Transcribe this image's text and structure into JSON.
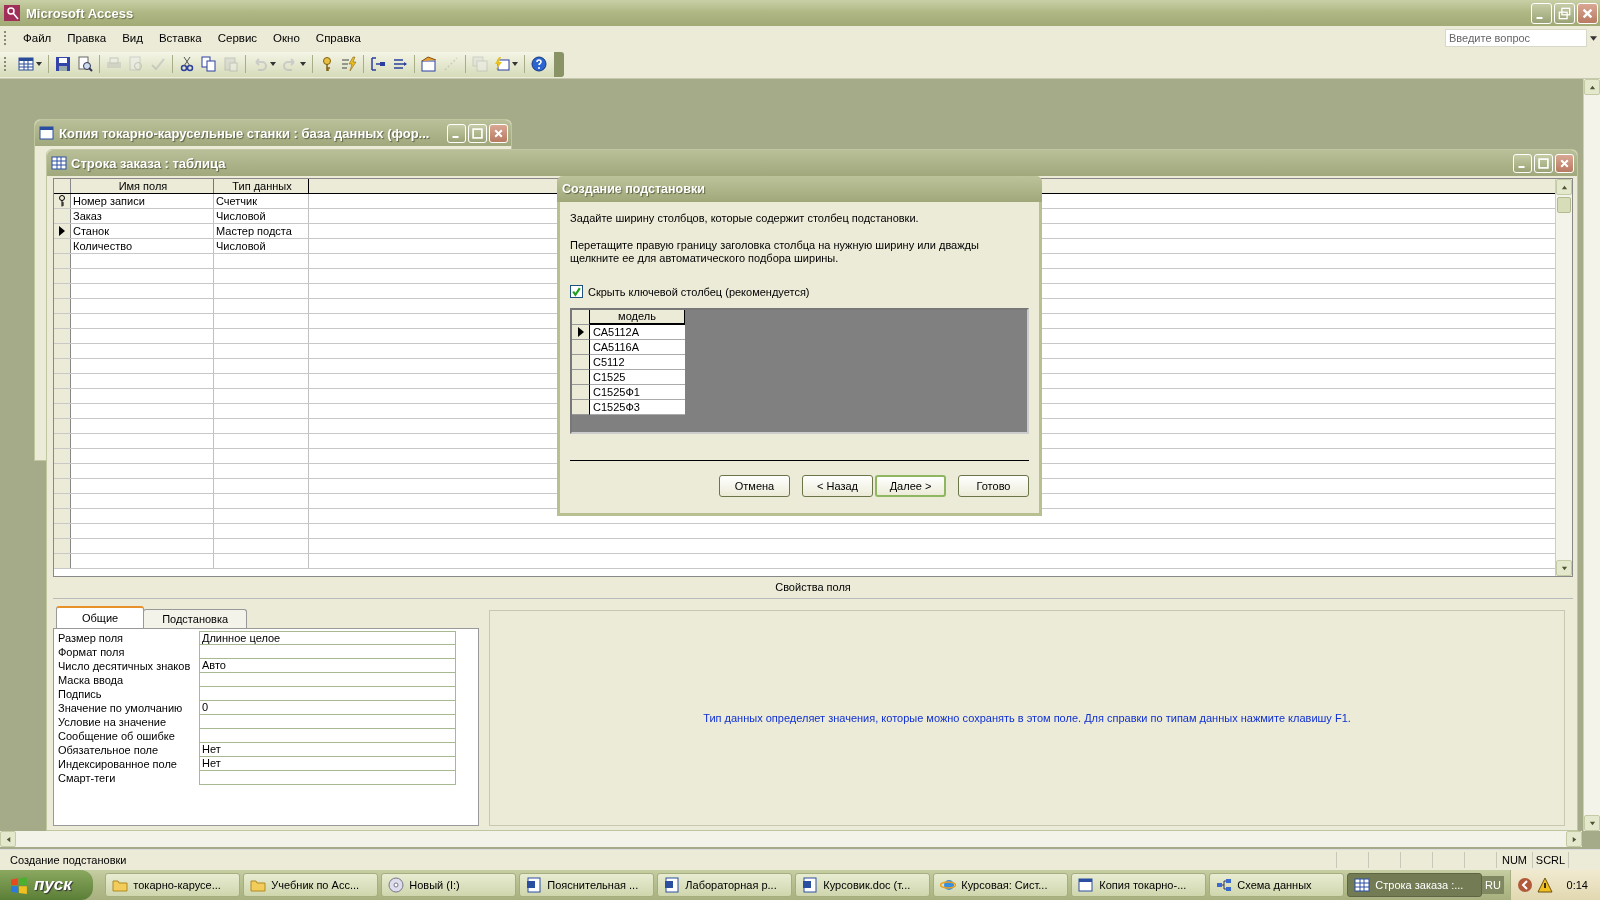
{
  "window": {
    "title": "Microsoft Access"
  },
  "menu": [
    "Файл",
    "Правка",
    "Вид",
    "Вставка",
    "Сервис",
    "Окно",
    "Справка"
  ],
  "help_box": {
    "placeholder": "Введите вопрос"
  },
  "toolbar": [
    [
      {
        "kind": "grid",
        "dropdown": true,
        "disabled": false
      }
    ],
    [
      {
        "kind": "save",
        "dropdown": false,
        "disabled": false
      },
      {
        "kind": "search",
        "dropdown": false,
        "disabled": false
      }
    ],
    [
      {
        "kind": "print",
        "dropdown": false,
        "disabled": true
      },
      {
        "kind": "preview",
        "dropdown": false,
        "disabled": true
      },
      {
        "kind": "spell",
        "dropdown": false,
        "disabled": true
      }
    ],
    [
      {
        "kind": "cut",
        "dropdown": false,
        "disabled": false
      },
      {
        "kind": "copy",
        "dropdown": false,
        "disabled": false
      },
      {
        "kind": "paste",
        "dropdown": false,
        "disabled": true
      }
    ],
    [
      {
        "kind": "undo",
        "dropdown": true,
        "disabled": true
      },
      {
        "kind": "redo",
        "dropdown": true,
        "disabled": true
      }
    ],
    [
      {
        "kind": "key",
        "dropdown": false,
        "disabled": false
      },
      {
        "kind": "lightning",
        "dropdown": false,
        "disabled": false
      }
    ],
    [
      {
        "kind": "insert",
        "dropdown": false,
        "disabled": false
      },
      {
        "kind": "delete",
        "dropdown": false,
        "disabled": false
      }
    ],
    [
      {
        "kind": "properties",
        "dropdown": false,
        "disabled": false
      },
      {
        "kind": "wand",
        "dropdown": false,
        "disabled": true
      }
    ],
    [
      {
        "kind": "windows",
        "dropdown": false,
        "disabled": true
      },
      {
        "kind": "new",
        "dropdown": true,
        "disabled": false
      }
    ],
    [
      {
        "kind": "help",
        "dropdown": false,
        "disabled": false
      }
    ]
  ],
  "database_window": {
    "title": "Копия токарно-карусельные станки : база данных (фор..."
  },
  "table_window": {
    "title": "Строка заказа : таблица",
    "columns": [
      "Имя поля",
      "Тип данных"
    ],
    "rows": [
      {
        "name": "Номер записи",
        "type": "Счетчик",
        "primary_key": true,
        "selected": false
      },
      {
        "name": "Заказ",
        "type": "Числовой",
        "primary_key": false,
        "selected": false
      },
      {
        "name": "Станок",
        "type": "Мастер подста",
        "primary_key": false,
        "selected": true
      },
      {
        "name": "Количество",
        "type": "Числовой",
        "primary_key": false,
        "selected": false
      }
    ]
  },
  "field_properties": {
    "caption": "Свойства поля",
    "tabs": [
      {
        "label": "Общие",
        "selected": true
      },
      {
        "label": "Подстановка",
        "selected": false
      }
    ],
    "rows": [
      {
        "label": "Размер поля",
        "value": "Длинное целое"
      },
      {
        "label": "Формат поля"
      },
      {
        "label": "Число десятичных знаков",
        "value": "Авто"
      },
      {
        "label": "Маска ввода"
      },
      {
        "label": "Подпись"
      },
      {
        "label": "Значение по умолчанию",
        "value": "0"
      },
      {
        "label": "Условие на значение"
      },
      {
        "label": "Сообщение об ошибке"
      },
      {
        "label": "Обязательное поле",
        "value": "Нет"
      },
      {
        "label": "Индексированное поле",
        "value": "Нет"
      },
      {
        "label": "Смарт-теги"
      }
    ],
    "hint": "Тип данных определяет значения, которые можно сохранять в этом поле.  Для справки по типам данных нажмите клавишу F1."
  },
  "dialog": {
    "title": "Создание подстановки",
    "instruction": "Задайте ширину столбцов, которые содержит столбец подстановки.",
    "description": "Перетащите правую границу заголовка столбца на нужную ширину или дважды щелкните ее для автоматического подбора ширины.",
    "checkbox": {
      "label": "Скрыть ключевой столбец (рекомендуется)",
      "checked": true
    },
    "preview": {
      "column": "модель",
      "rows": [
        {
          "value": "СА5112А",
          "selected": true
        },
        {
          "value": "СА5116А",
          "selected": false
        },
        {
          "value": "С5112",
          "selected": false
        },
        {
          "value": "С1525",
          "selected": false
        },
        {
          "value": "С1525Ф1",
          "selected": false
        },
        {
          "value": "С1525Ф3",
          "selected": false
        }
      ]
    },
    "buttons": [
      {
        "label": "Отмена",
        "default": false
      },
      {
        "label": "< Назад",
        "default": false
      },
      {
        "label": "Далее >",
        "default": true
      },
      {
        "label": "Готово",
        "default": false
      }
    ]
  },
  "status_bar": {
    "text": "Создание подстановки",
    "indicators": [
      "NUM",
      "SCRL"
    ]
  },
  "taskbar": {
    "start": "пуск",
    "tasks": [
      {
        "label": "токарно-карусе...",
        "kind": "folder",
        "selected": false
      },
      {
        "label": "Учебник по Acc...",
        "kind": "folder",
        "selected": false
      },
      {
        "label": "Новый (I:)",
        "kind": "disc",
        "selected": false
      },
      {
        "label": "Пояснительная ...",
        "kind": "document",
        "selected": false
      },
      {
        "label": "Лабораторная р...",
        "kind": "document",
        "selected": false
      },
      {
        "label": "Курсовик.doc (т...",
        "kind": "document",
        "selected": false
      },
      {
        "label": "Курсовая: Сист...",
        "kind": "browser",
        "selected": false
      },
      {
        "label": "Копия токарно-...",
        "kind": "database",
        "selected": false
      },
      {
        "label": "Схема данных",
        "kind": "diagram",
        "selected": false
      },
      {
        "label": "Строка заказа :...",
        "kind": "table",
        "selected": true
      }
    ],
    "language": "RU",
    "clock": "0:14"
  }
}
